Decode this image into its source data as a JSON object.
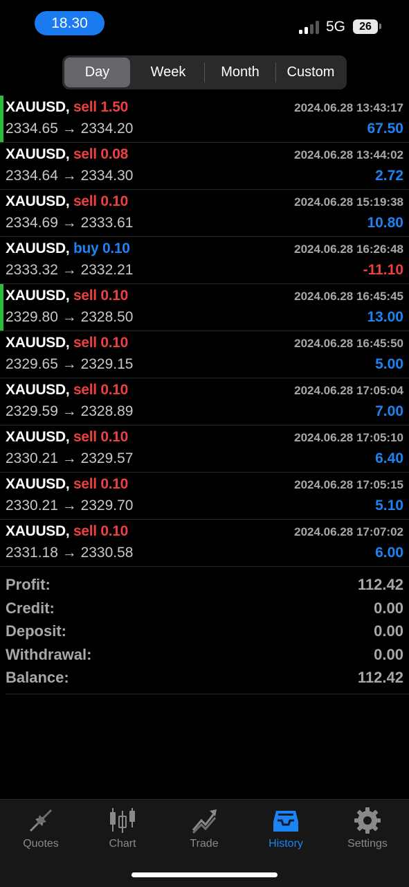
{
  "status_bar": {
    "time": "18.30",
    "network": "5G",
    "battery": "26"
  },
  "period_tabs": [
    {
      "label": "Day",
      "active": true
    },
    {
      "label": "Week",
      "active": false
    },
    {
      "label": "Month",
      "active": false
    },
    {
      "label": "Custom",
      "active": false
    }
  ],
  "deals": [
    {
      "symbol": "XAUUSD,",
      "type": "sell",
      "volume": "1.50",
      "prices": "2334.65 → 2334.20",
      "time": "2024.06.28 13:43:17",
      "profit": "67.50",
      "marked": true
    },
    {
      "symbol": "XAUUSD,",
      "type": "sell",
      "volume": "0.08",
      "prices": "2334.64 → 2334.30",
      "time": "2024.06.28 13:44:02",
      "profit": "2.72",
      "marked": false
    },
    {
      "symbol": "XAUUSD,",
      "type": "sell",
      "volume": "0.10",
      "prices": "2334.69 → 2333.61",
      "time": "2024.06.28 15:19:38",
      "profit": "10.80",
      "marked": false
    },
    {
      "symbol": "XAUUSD,",
      "type": "buy",
      "volume": "0.10",
      "prices": "2333.32 → 2332.21",
      "time": "2024.06.28 16:26:48",
      "profit": "-11.10",
      "marked": false
    },
    {
      "symbol": "XAUUSD,",
      "type": "sell",
      "volume": "0.10",
      "prices": "2329.80 → 2328.50",
      "time": "2024.06.28 16:45:45",
      "profit": "13.00",
      "marked": true
    },
    {
      "symbol": "XAUUSD,",
      "type": "sell",
      "volume": "0.10",
      "prices": "2329.65 → 2329.15",
      "time": "2024.06.28 16:45:50",
      "profit": "5.00",
      "marked": false
    },
    {
      "symbol": "XAUUSD,",
      "type": "sell",
      "volume": "0.10",
      "prices": "2329.59 → 2328.89",
      "time": "2024.06.28 17:05:04",
      "profit": "7.00",
      "marked": false
    },
    {
      "symbol": "XAUUSD,",
      "type": "sell",
      "volume": "0.10",
      "prices": "2330.21 → 2329.57",
      "time": "2024.06.28 17:05:10",
      "profit": "6.40",
      "marked": false
    },
    {
      "symbol": "XAUUSD,",
      "type": "sell",
      "volume": "0.10",
      "prices": "2330.21 → 2329.70",
      "time": "2024.06.28 17:05:15",
      "profit": "5.10",
      "marked": false
    },
    {
      "symbol": "XAUUSD,",
      "type": "sell",
      "volume": "0.10",
      "prices": "2331.18 → 2330.58",
      "time": "2024.06.28 17:07:02",
      "profit": "6.00",
      "marked": false
    }
  ],
  "summary": [
    {
      "label": "Profit:",
      "value": "112.42"
    },
    {
      "label": "Credit:",
      "value": "0.00"
    },
    {
      "label": "Deposit:",
      "value": "0.00"
    },
    {
      "label": "Withdrawal:",
      "value": "0.00"
    },
    {
      "label": "Balance:",
      "value": "112.42"
    }
  ],
  "bottom_tabs": [
    {
      "label": "Quotes",
      "icon": "quotes-arrows-icon",
      "active": false
    },
    {
      "label": "Chart",
      "icon": "candlestick-chart-icon",
      "active": false
    },
    {
      "label": "Trade",
      "icon": "trade-trend-icon",
      "active": false
    },
    {
      "label": "History",
      "icon": "history-inbox-icon",
      "active": true
    },
    {
      "label": "Settings",
      "icon": "settings-gear-icon",
      "active": false
    }
  ],
  "colors": {
    "sell": "#ec4141",
    "buy": "#1c84f2",
    "profit_positive": "#1c84f2",
    "profit_negative": "#ec4141",
    "active_tab": "#1c84f2",
    "marker": "#2dbd3a"
  }
}
